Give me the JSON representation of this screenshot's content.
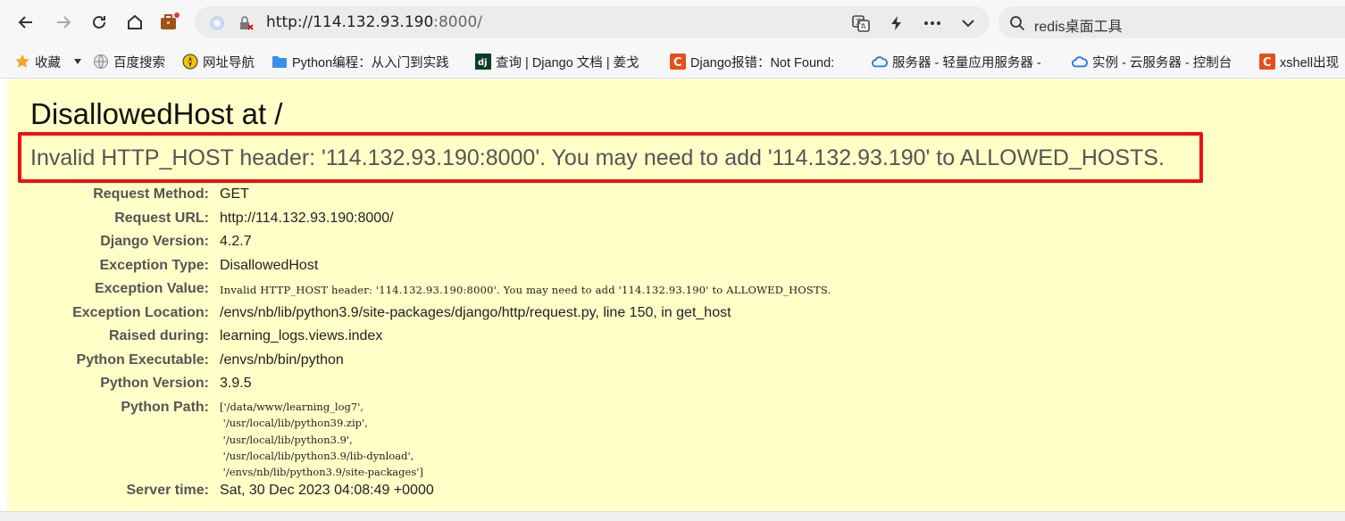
{
  "browser": {
    "url_host": "http://114.132.93.190",
    "url_rest": ":8000/",
    "search_text": "redis桌面工具"
  },
  "bookmarks": [
    {
      "label": "收藏",
      "icon": "star-icon"
    },
    {
      "label": "百度搜索",
      "icon": "globe-icon"
    },
    {
      "label": "网址导航",
      "icon": "compass-icon"
    },
    {
      "label": "Python编程：从入门到实践",
      "icon": "folder-icon"
    },
    {
      "label": "查询 | Django 文档 | 姜戈",
      "icon": "dj-icon"
    },
    {
      "label": "Django报错：Not Found:",
      "icon": "c-icon"
    },
    {
      "label": "服务器 - 轻量应用服务器 -",
      "icon": "cloud-icon"
    },
    {
      "label": "实例 - 云服务器 - 控制台",
      "icon": "cloud-icon"
    },
    {
      "label": "xshell出现",
      "icon": "c-icon"
    }
  ],
  "error": {
    "title": "DisallowedHost at /",
    "message": "Invalid HTTP_HOST header: '114.132.93.190:8000'. You may need to add '114.132.93.190' to ALLOWED_HOSTS."
  },
  "meta": [
    {
      "key": "Request Method:",
      "value": "GET"
    },
    {
      "key": "Request URL:",
      "value": "http://114.132.93.190:8000/"
    },
    {
      "key": "Django Version:",
      "value": "4.2.7"
    },
    {
      "key": "Exception Type:",
      "value": "DisallowedHost"
    },
    {
      "key": "Exception Value:",
      "value": "Invalid HTTP_HOST header: '114.132.93.190:8000'. You may need to add '114.132.93.190' to ALLOWED_HOSTS."
    },
    {
      "key": "Exception Location:",
      "value": "/envs/nb/lib/python3.9/site-packages/django/http/request.py, line 150, in get_host"
    },
    {
      "key": "Raised during:",
      "value": "learning_logs.views.index"
    },
    {
      "key": "Python Executable:",
      "value": "/envs/nb/bin/python"
    },
    {
      "key": "Python Version:",
      "value": "3.9.5"
    },
    {
      "key": "Python Path:",
      "value": ""
    },
    {
      "key": "Server time:",
      "value": "Sat, 30 Dec 2023 04:08:49 +0000"
    }
  ],
  "python_path": "['/data/www/learning_log7',\n '/usr/local/lib/python39.zip',\n '/usr/local/lib/python3.9',\n '/usr/local/lib/python3.9/lib-dynload',\n '/envs/nb/lib/python3.9/site-packages']"
}
